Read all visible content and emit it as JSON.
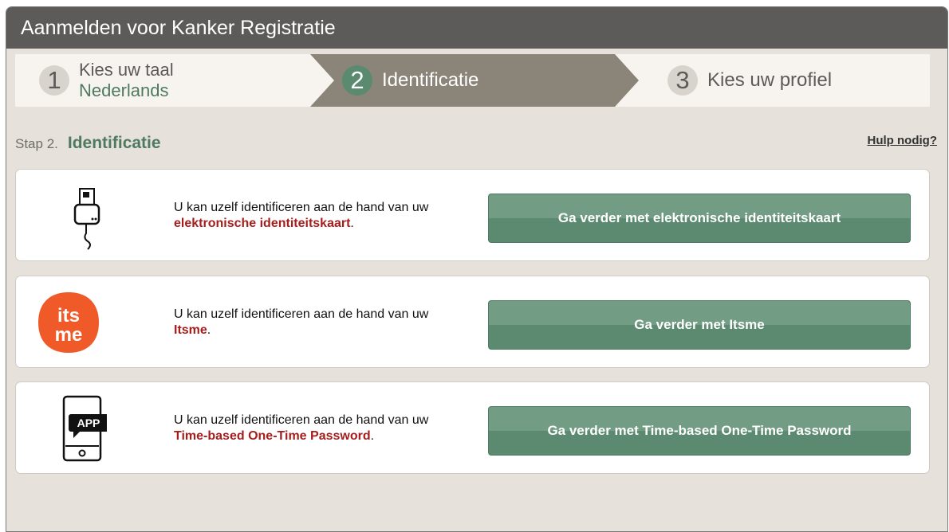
{
  "window": {
    "title": "Aanmelden voor Kanker Registratie"
  },
  "steps": [
    {
      "number": "1",
      "label": "Kies uw taal",
      "sublabel": "Nederlands"
    },
    {
      "number": "2",
      "label": "Identificatie"
    },
    {
      "number": "3",
      "label": "Kies uw profiel"
    }
  ],
  "heading": {
    "prefix": "Stap 2.",
    "title": "Identificatie"
  },
  "help_link": "Hulp nodig?",
  "options": [
    {
      "icon": "card-reader-icon",
      "text": "U kan uzelf identificeren aan de hand van uw",
      "method": "elektronische identiteitskaart",
      "suffix": ".",
      "button": "Ga verder met elektronische identiteitskaart"
    },
    {
      "icon": "itsme-logo",
      "logo_line1": "its",
      "logo_line2": "me",
      "text": "U kan uzelf identificeren aan de hand van uw",
      "method": "Itsme",
      "suffix": ".",
      "button": "Ga verder met Itsme"
    },
    {
      "icon": "phone-app-icon",
      "app_label": "APP",
      "text": "U kan uzelf identificeren aan de hand van uw",
      "method": "Time-based One-Time Password",
      "suffix": ".",
      "button": "Ga verder met Time-based One-Time Password"
    }
  ],
  "colors": {
    "accent_green": "#5a8a6f",
    "method_red": "#a51d1d",
    "titlebar": "#5c5b59",
    "active_step": "#8b8478",
    "itsme_orange": "#f05a28"
  }
}
